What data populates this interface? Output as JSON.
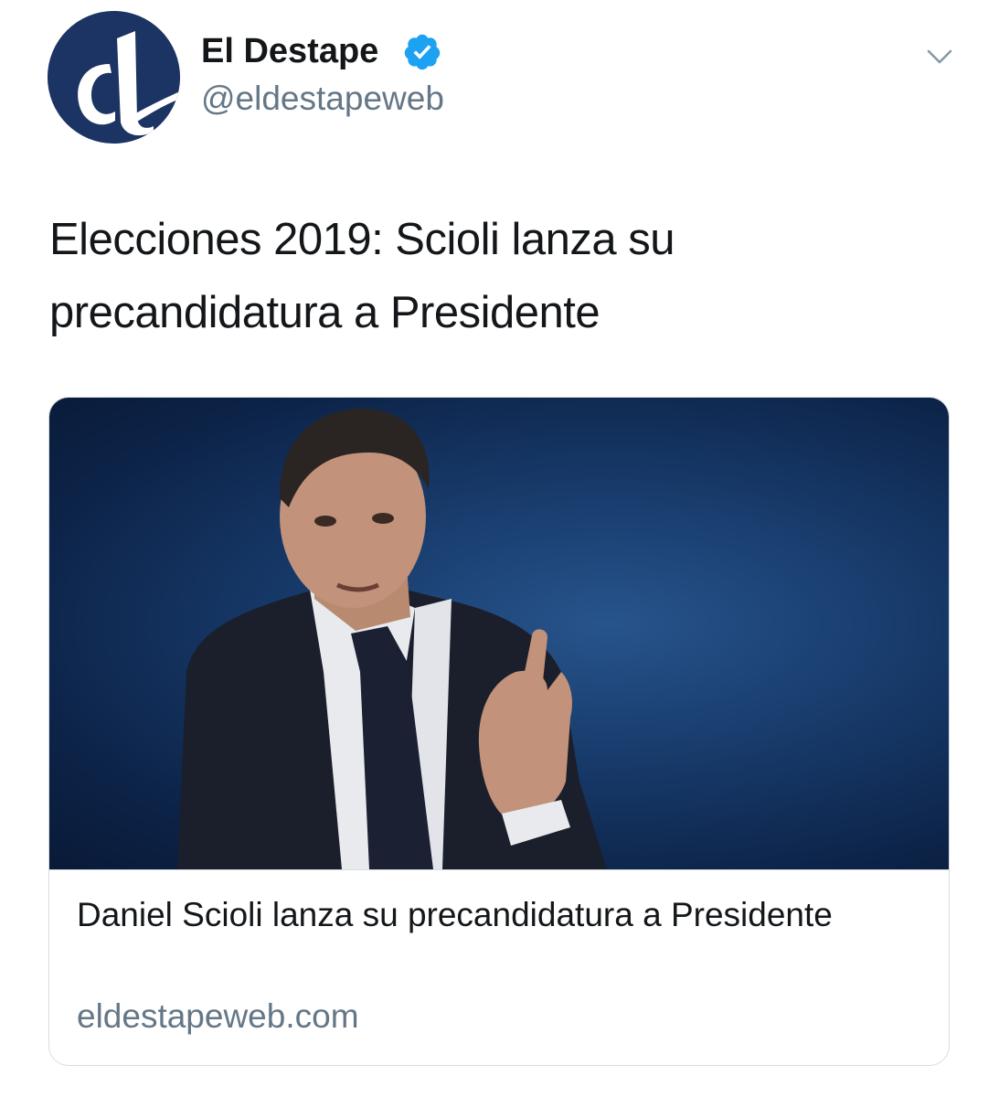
{
  "account": {
    "display_name": "El Destape",
    "handle": "@eldestapeweb",
    "verified": true,
    "avatar_icon": "el-destape-logo",
    "verified_icon": "verified-badge-icon",
    "menu_icon": "chevron-down-icon"
  },
  "tweet": {
    "text_line1": "Elecciones 2019: Scioli lanza su",
    "text_line2": "precandidatura a Presidente"
  },
  "card": {
    "image_icon": "article-photo",
    "title": "Daniel Scioli lanza su precandidatura a Presidente",
    "domain": "eldestapeweb.com"
  },
  "colors": {
    "text_primary": "#14171a",
    "text_secondary": "#657786",
    "verified_blue": "#1da1f2",
    "card_border": "#d6dde3",
    "logo_navy": "#1c3463"
  }
}
